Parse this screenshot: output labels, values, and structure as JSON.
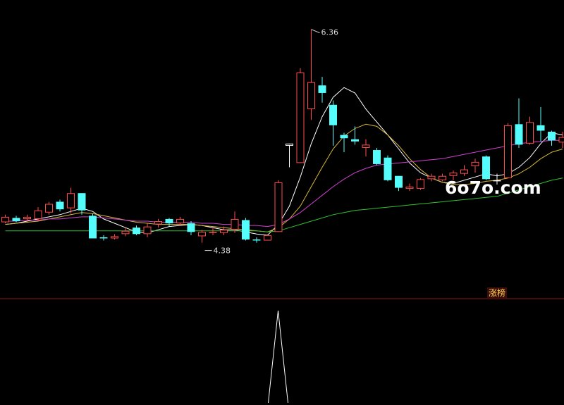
{
  "chart_data": {
    "type": "candlestick",
    "title": "",
    "ylim": [
      3.9,
      6.6
    ],
    "price_annotations": {
      "high": "6.36",
      "low": "4.38"
    },
    "watermark": "6o7o.com",
    "signal_badge": "涨榜",
    "colors": {
      "background": "#000000",
      "up": "#ff4b4b",
      "down": "#54fcfc",
      "ma_white": "#ffffff",
      "ma_yellow": "#d9b83a",
      "ma_magenta": "#d040d0",
      "ma_green": "#30c030",
      "divider": "#8b1a1a",
      "signal_line": "#ffffff"
    },
    "candles": [
      [
        4.57,
        4.62,
        4.56,
        4.64,
        "up"
      ],
      [
        4.61,
        4.58,
        4.57,
        4.63,
        "down"
      ],
      [
        4.6,
        4.62,
        4.58,
        4.64,
        "up"
      ],
      [
        4.6,
        4.68,
        4.58,
        4.71,
        "up"
      ],
      [
        4.66,
        4.74,
        4.64,
        4.76,
        "up"
      ],
      [
        4.76,
        4.69,
        4.67,
        4.78,
        "down"
      ],
      [
        4.7,
        4.84,
        4.65,
        4.89,
        "up"
      ],
      [
        4.84,
        4.68,
        4.64,
        4.84,
        "down"
      ],
      [
        4.63,
        4.42,
        4.42,
        4.65,
        "down"
      ],
      [
        4.43,
        4.42,
        4.4,
        4.45,
        "down"
      ],
      [
        4.42,
        4.44,
        4.41,
        4.46,
        "up"
      ],
      [
        4.46,
        4.49,
        4.44,
        4.52,
        "up"
      ],
      [
        4.52,
        4.46,
        4.45,
        4.54,
        "down"
      ],
      [
        4.46,
        4.53,
        4.43,
        4.56,
        "up"
      ],
      [
        4.55,
        4.58,
        4.52,
        4.6,
        "up"
      ],
      [
        4.6,
        4.56,
        4.53,
        4.61,
        "down"
      ],
      [
        4.56,
        4.6,
        4.54,
        4.62,
        "up"
      ],
      [
        4.56,
        4.48,
        4.45,
        4.58,
        "down"
      ],
      [
        4.44,
        4.48,
        4.38,
        4.5,
        "up"
      ],
      [
        4.47,
        4.48,
        4.45,
        4.52,
        "up"
      ],
      [
        4.47,
        4.5,
        4.45,
        4.53,
        "up"
      ],
      [
        4.5,
        4.6,
        4.47,
        4.67,
        "up"
      ],
      [
        4.59,
        4.41,
        4.4,
        4.61,
        "down"
      ],
      [
        4.4,
        4.41,
        4.38,
        4.43,
        "down"
      ],
      [
        4.4,
        4.45,
        4.4,
        4.46,
        "up"
      ],
      [
        4.48,
        4.94,
        4.48,
        4.96,
        "up"
      ],
      [
        5.3,
        5.28,
        5.08,
        5.3,
        "flat"
      ],
      [
        5.12,
        5.96,
        5.12,
        6.0,
        "up"
      ],
      [
        5.62,
        5.87,
        5.52,
        6.36,
        "up"
      ],
      [
        5.84,
        5.77,
        5.68,
        5.92,
        "down"
      ],
      [
        5.66,
        5.47,
        5.28,
        5.7,
        "down"
      ],
      [
        5.38,
        5.35,
        5.22,
        5.4,
        "down"
      ],
      [
        5.34,
        5.32,
        5.29,
        5.46,
        "down"
      ],
      [
        5.26,
        5.29,
        5.18,
        5.34,
        "up"
      ],
      [
        5.24,
        5.11,
        5.1,
        5.26,
        "down"
      ],
      [
        5.17,
        4.96,
        4.95,
        5.19,
        "down"
      ],
      [
        5.0,
        4.89,
        4.86,
        5.0,
        "down"
      ],
      [
        4.88,
        4.9,
        4.86,
        4.93,
        "up"
      ],
      [
        4.88,
        4.97,
        4.87,
        4.98,
        "up"
      ],
      [
        4.97,
        5.0,
        4.95,
        5.02,
        "up"
      ],
      [
        4.96,
        5.0,
        4.95,
        5.02,
        "up"
      ],
      [
        5.0,
        5.03,
        4.96,
        5.05,
        "up"
      ],
      [
        5.02,
        5.06,
        5.0,
        5.1,
        "up"
      ],
      [
        5.09,
        5.13,
        5.03,
        5.16,
        "up"
      ],
      [
        5.18,
        4.97,
        4.96,
        5.19,
        "down"
      ],
      [
        4.96,
        4.96,
        4.92,
        5.02,
        "flat"
      ],
      [
        4.98,
        5.47,
        4.98,
        5.49,
        "up"
      ],
      [
        5.48,
        5.29,
        5.26,
        5.72,
        "down"
      ],
      [
        5.3,
        5.5,
        5.29,
        5.55,
        "up"
      ],
      [
        5.47,
        5.42,
        5.32,
        5.64,
        "down"
      ],
      [
        5.41,
        5.33,
        5.28,
        5.42,
        "down"
      ],
      [
        5.31,
        5.36,
        5.26,
        5.41,
        "up"
      ]
    ],
    "moving_averages": [
      {
        "color_key": "ma_white",
        "values": [
          4.55,
          4.56,
          4.58,
          4.6,
          4.62,
          4.64,
          4.67,
          4.7,
          4.67,
          4.6,
          4.56,
          4.52,
          4.48,
          4.47,
          4.5,
          4.53,
          4.54,
          4.55,
          4.54,
          4.52,
          4.5,
          4.5,
          4.48,
          4.46,
          4.45,
          4.55,
          4.72,
          4.99,
          5.3,
          5.55,
          5.73,
          5.82,
          5.77,
          5.62,
          5.5,
          5.38,
          5.25,
          5.12,
          5.03,
          4.98,
          4.94,
          4.93,
          4.96,
          4.99,
          5.02,
          5.0,
          5.02,
          5.08,
          5.17,
          5.3,
          5.4,
          5.38
        ]
      },
      {
        "color_key": "ma_yellow",
        "values": [
          4.55,
          4.56,
          4.57,
          4.58,
          4.6,
          4.62,
          4.64,
          4.66,
          4.65,
          4.63,
          4.61,
          4.59,
          4.57,
          4.56,
          4.55,
          4.55,
          4.55,
          4.55,
          4.54,
          4.53,
          4.52,
          4.51,
          4.5,
          4.49,
          4.48,
          4.52,
          4.6,
          4.72,
          4.9,
          5.08,
          5.25,
          5.37,
          5.44,
          5.48,
          5.46,
          5.38,
          5.28,
          5.16,
          5.06,
          4.98,
          4.94,
          4.92,
          4.92,
          4.93,
          4.95,
          4.96,
          4.98,
          5.02,
          5.08,
          5.16,
          5.22,
          5.25
        ]
      },
      {
        "color_key": "ma_magenta",
        "values": [
          4.58,
          4.58,
          4.59,
          4.59,
          4.6,
          4.6,
          4.61,
          4.62,
          4.62,
          4.61,
          4.6,
          4.59,
          4.58,
          4.58,
          4.57,
          4.57,
          4.57,
          4.57,
          4.56,
          4.56,
          4.55,
          4.55,
          4.54,
          4.54,
          4.53,
          4.55,
          4.6,
          4.66,
          4.74,
          4.82,
          4.9,
          4.97,
          5.03,
          5.07,
          5.1,
          5.11,
          5.12,
          5.13,
          5.14,
          5.15,
          5.16,
          5.18,
          5.2,
          5.22,
          5.24,
          5.26,
          5.28,
          5.3,
          5.31,
          5.32,
          5.33,
          5.33
        ]
      },
      {
        "color_key": "ma_green",
        "values": [
          4.49,
          4.49,
          4.49,
          4.49,
          4.49,
          4.49,
          4.49,
          4.49,
          4.49,
          4.49,
          4.49,
          4.49,
          4.49,
          4.49,
          4.49,
          4.49,
          4.49,
          4.49,
          4.49,
          4.49,
          4.49,
          4.49,
          4.49,
          4.49,
          4.48,
          4.49,
          4.52,
          4.55,
          4.58,
          4.61,
          4.64,
          4.66,
          4.68,
          4.69,
          4.7,
          4.71,
          4.72,
          4.73,
          4.74,
          4.75,
          4.76,
          4.77,
          4.78,
          4.79,
          4.8,
          4.81,
          4.84,
          4.87,
          4.9,
          4.93,
          4.96,
          4.98
        ]
      }
    ],
    "signal": {
      "spike_at_index": 25,
      "level": 1.0
    }
  }
}
